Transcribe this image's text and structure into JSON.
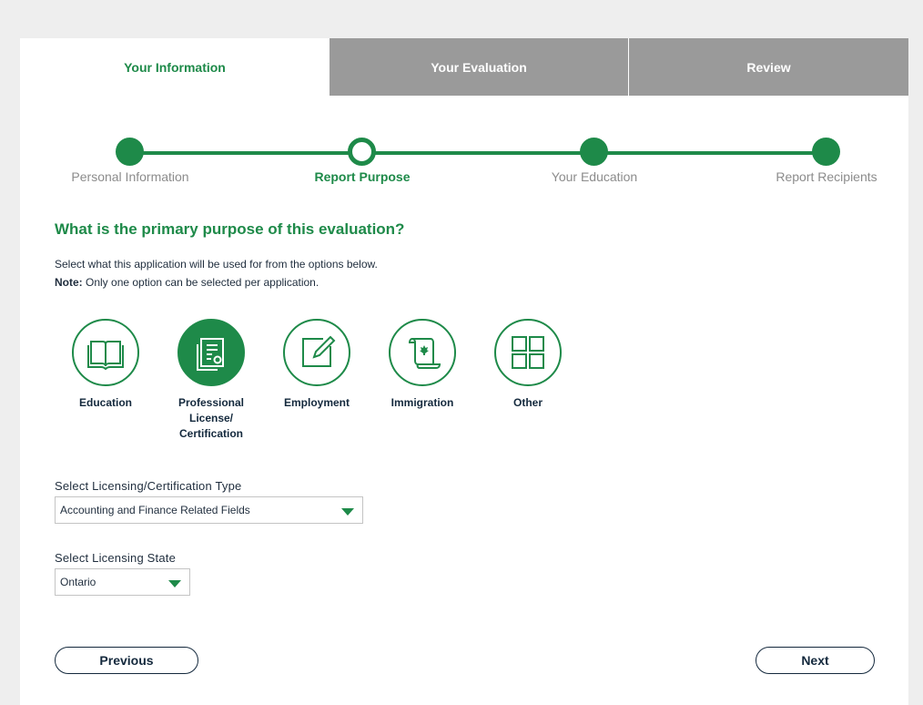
{
  "tabs": {
    "info": "Your Information",
    "evaluation": "Your Evaluation",
    "review": "Review"
  },
  "steps": [
    "Personal Information",
    "Report Purpose",
    "Your Education",
    "Report Recipients"
  ],
  "heading": "What is the primary purpose of this evaluation?",
  "instruction": "Select what this application will be used for from the options below.",
  "note_label": "Note:",
  "note_text": " Only one option can be selected per application.",
  "options": {
    "education": "Education",
    "professional": "Professional License/ Certification",
    "employment": "Employment",
    "immigration": "Immigration",
    "other": "Other"
  },
  "selected_option": "Professional License/ Certification",
  "licensing_type": {
    "label": "Select Licensing/Certification Type",
    "value": "Accounting and Finance Related Fields"
  },
  "licensing_state": {
    "label": "Select Licensing State",
    "value": "Ontario"
  },
  "buttons": {
    "previous": "Previous",
    "next": "Next"
  },
  "colors": {
    "accent": "#1e8a49",
    "inactive_tab": "#9a9a9a",
    "text_dark": "#14293d"
  }
}
